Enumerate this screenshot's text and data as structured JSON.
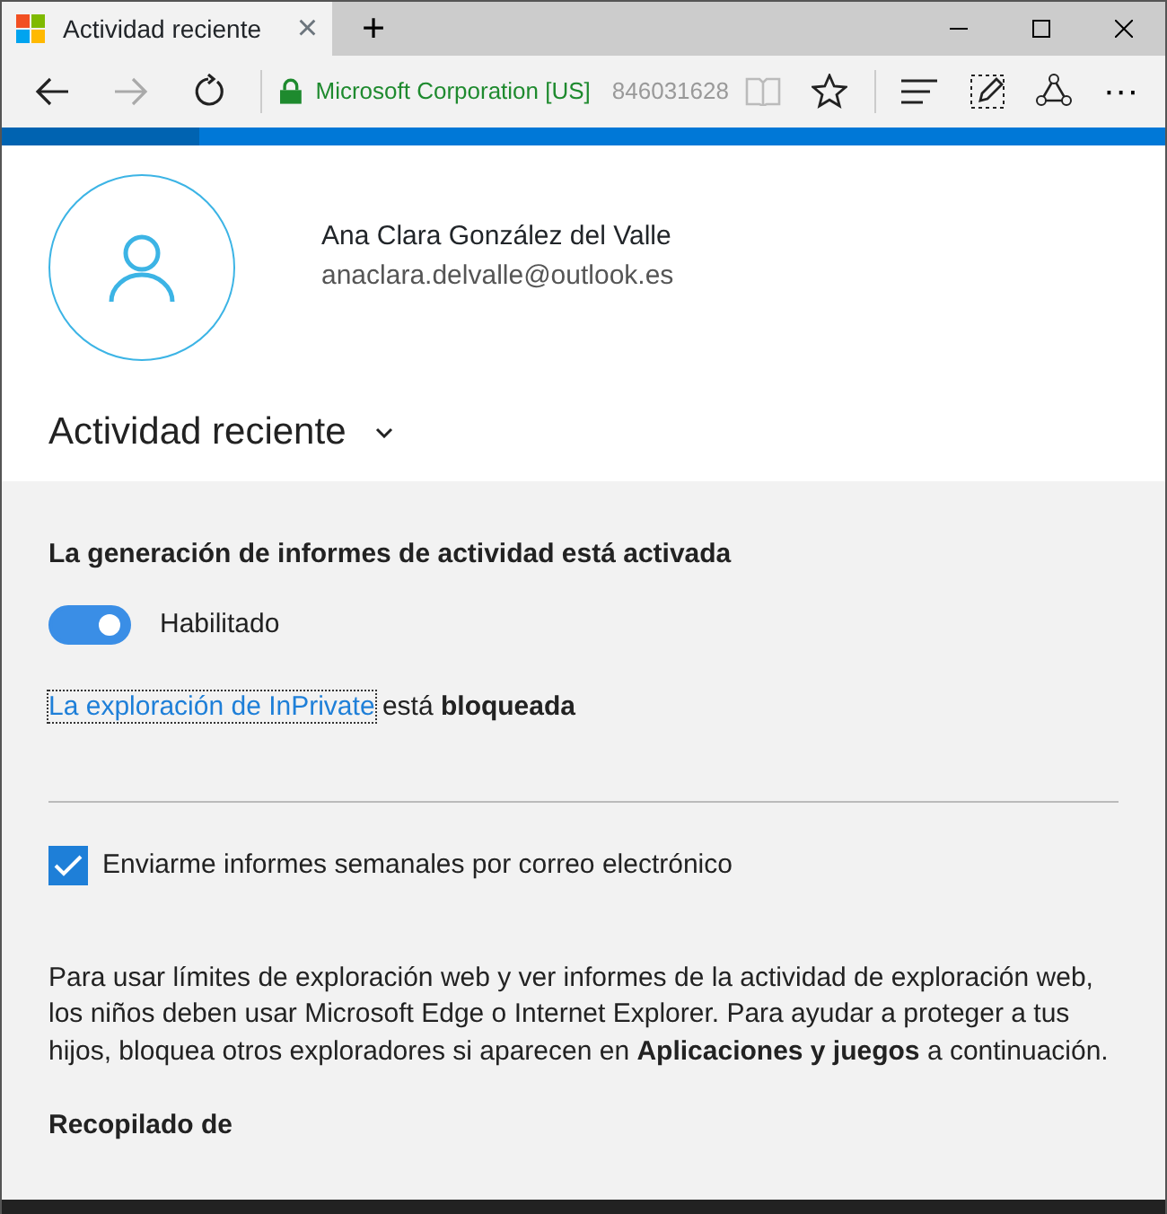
{
  "tab": {
    "title": "Actividad reciente",
    "close": "×",
    "new_tab": "+"
  },
  "toolbar": {
    "nav": [
      {
        "kind": "back",
        "disabled": false
      },
      {
        "kind": "forward",
        "disabled": true
      },
      {
        "kind": "refresh",
        "disabled": false
      }
    ],
    "site_identity": "Microsoft Corporation [US]",
    "url": "846031628",
    "more": "···"
  },
  "loading": {
    "level": 0.17
  },
  "profile": {
    "name": "Ana Clara González del Valle",
    "email": "anaclara.delvalle@outlook.es"
  },
  "section_title": "Actividad reciente",
  "settings": {
    "heading": "La generación de informes de actividad está activada",
    "toggle": {
      "label": "Habilitado",
      "on": true
    },
    "inprivate": {
      "link": "La exploración de InPrivate",
      "rest": "está **bloqueada**"
    },
    "weekly": {
      "label": "Enviarme informes semanales por correo electrónico",
      "checked": true
    },
    "info": "Para usar límites de exploración web y ver informes de la actividad de exploración web, los niños deben usar Microsoft Edge o Internet Explorer. Para ayudar a proteger a tus hijos, bloquea otros exploradores si aparecen en **Aplicaciones y juegos** a continuación.",
    "collected": "Recopilado de"
  }
}
